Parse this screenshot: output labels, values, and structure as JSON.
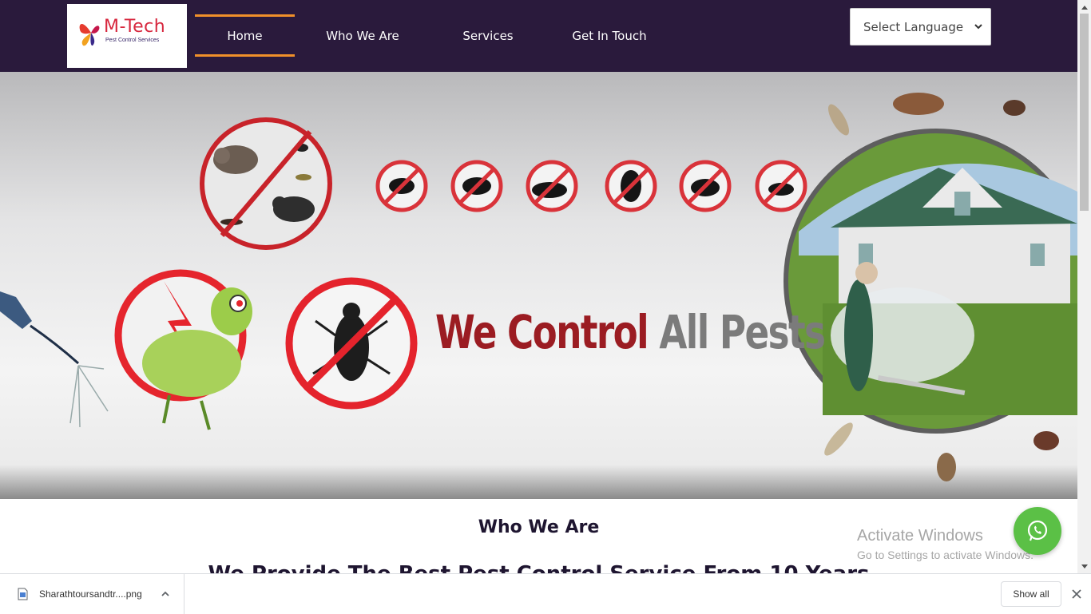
{
  "header": {
    "logo": {
      "title": "M-Tech",
      "subtitle": "Pest Control Services"
    },
    "nav": [
      {
        "label": "Home",
        "active": true
      },
      {
        "label": "Who We Are",
        "active": false
      },
      {
        "label": "Services",
        "active": false
      },
      {
        "label": "Get In Touch",
        "active": false
      }
    ],
    "language_select": {
      "value": "Select Language"
    }
  },
  "hero": {
    "headline_part1": "We Control",
    "headline_part2": "All Pests"
  },
  "about": {
    "title": "Who We Are",
    "subtitle": "We Provide The Best Pest Control Service From 10 Years"
  },
  "watermark": {
    "line1": "Activate Windows",
    "line2": "Go to Settings to activate Windows."
  },
  "download_bar": {
    "file_name": "Sharathtoursandtr....png",
    "show_all_label": "Show all"
  },
  "colors": {
    "header_bg": "#2a1a3c",
    "nav_accent": "#f0902a",
    "headline_red": "#9b1c22",
    "headline_gray": "#7b7b7b",
    "whatsapp_green": "#5bc046"
  }
}
